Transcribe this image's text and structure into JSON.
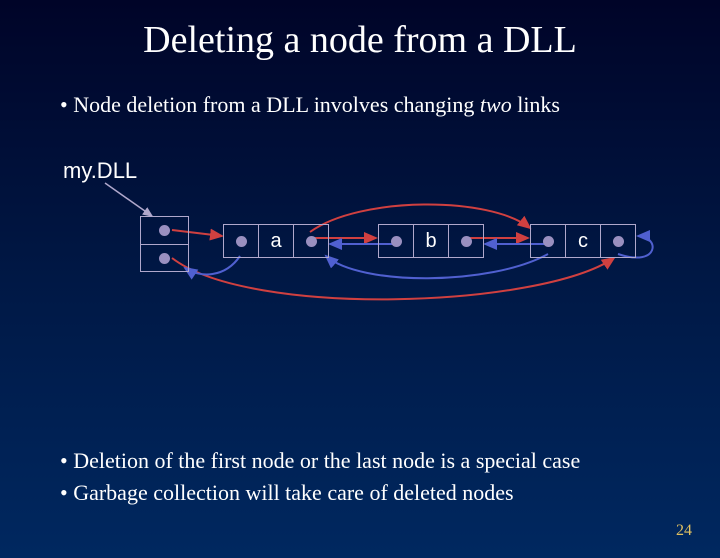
{
  "title": "Deleting a node from a DLL",
  "bullet1_pre": "Node deletion from a DLL involves changing ",
  "bullet1_em": "two",
  "bullet1_post": " links",
  "mydll_label": "my.DLL",
  "nodes": {
    "a": "a",
    "b": "b",
    "c": "c"
  },
  "bullet2": "Deletion of the first node or the last node is a special case",
  "bullet3": "Garbage collection will take care of deleted nodes",
  "page_number": "24",
  "colors": {
    "arrow_red": "#d04040",
    "arrow_blue": "#5060d0",
    "box_border": "#b0a8cc",
    "dot": "#9a90c0"
  }
}
